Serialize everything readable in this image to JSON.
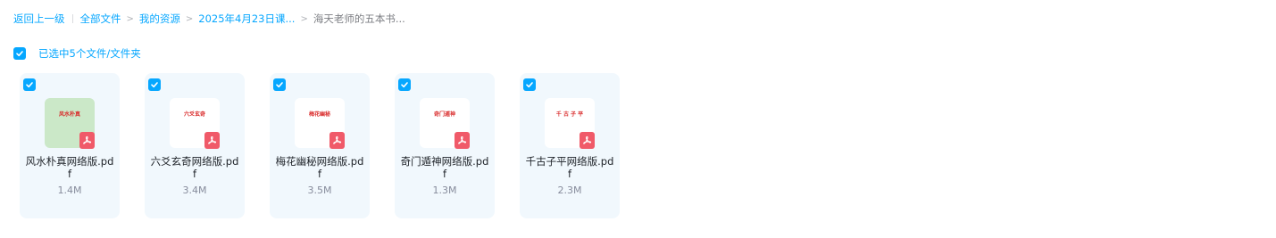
{
  "breadcrumb": {
    "back": "返回上一级",
    "all_files": "全部文件",
    "my_resources": "我的资源",
    "folder": "2025年4月23日课...",
    "current": "海天老师的五本书...",
    "separator": ">"
  },
  "selection": {
    "text": "已选中5个文件/文件夹"
  },
  "accent_color": "#06a7ff",
  "files": [
    {
      "name": "风水朴真网络版.pdf",
      "size": "1.4M",
      "thumb_text": "风水朴真",
      "thumb_bg": "#cbe8c8",
      "icon": "pdf-icon"
    },
    {
      "name": "六爻玄奇网络版.pdf",
      "size": "3.4M",
      "thumb_text": "六爻玄奇",
      "thumb_bg": "#ffffff",
      "icon": "pdf-icon"
    },
    {
      "name": "梅花幽秘网络版.pdf",
      "size": "3.5M",
      "thumb_text": "梅花幽秘",
      "thumb_bg": "#ffffff",
      "icon": "pdf-icon"
    },
    {
      "name": "奇门遁神网络版.pdf",
      "size": "1.3M",
      "thumb_text": "奇门遁神",
      "thumb_bg": "#ffffff",
      "icon": "pdf-icon"
    },
    {
      "name": "千古子平网络版.pdf",
      "size": "2.3M",
      "thumb_text": "千 古 子 平",
      "thumb_bg": "#ffffff",
      "icon": "pdf-icon"
    }
  ]
}
